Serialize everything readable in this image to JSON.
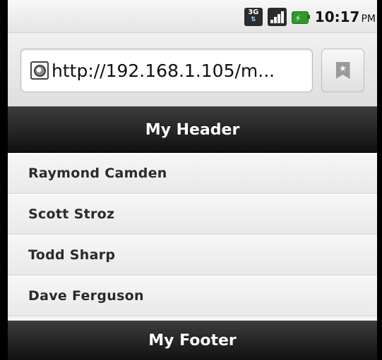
{
  "status_bar": {
    "network": "3G",
    "time": "10:17",
    "ampm": "PM"
  },
  "browser": {
    "url": "http://192.168.1.105/m..."
  },
  "page": {
    "header_title": "My Header",
    "footer_title": "My Footer",
    "list_items": [
      {
        "label": "Raymond Camden"
      },
      {
        "label": "Scott Stroz"
      },
      {
        "label": "Todd Sharp"
      },
      {
        "label": "Dave Ferguson"
      }
    ]
  },
  "colors": {
    "bar": "#1a1a1a",
    "list_bg": "#efefef",
    "battery": "#2e9a2e"
  }
}
